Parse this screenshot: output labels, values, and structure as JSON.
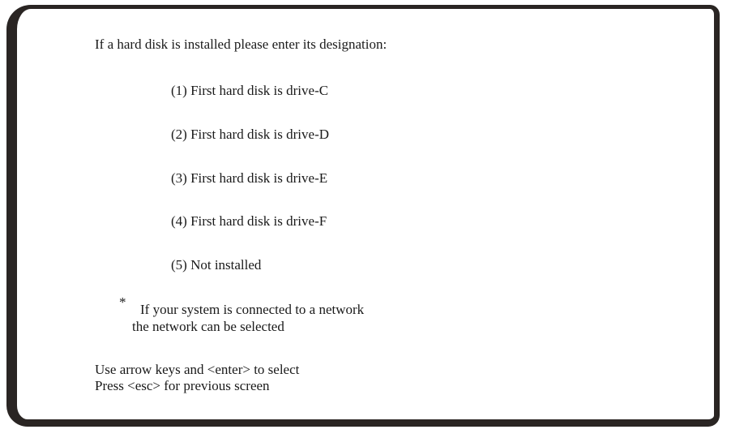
{
  "prompt": "If a hard disk is installed please enter its designation:",
  "options": [
    {
      "label": "(1) First hard disk is drive-C"
    },
    {
      "label": "(2) First hard disk is drive-D"
    },
    {
      "label": "(3) First hard disk is drive-E"
    },
    {
      "label": "(4) First hard disk is drive-F"
    },
    {
      "label": "(5) Not installed"
    }
  ],
  "note": {
    "marker": "*",
    "line1": "If your system is connected to a network",
    "line2": "the network can be selected"
  },
  "help": {
    "line1": "Use arrow keys and <enter> to select",
    "line2": "Press <esc> for previous screen"
  }
}
